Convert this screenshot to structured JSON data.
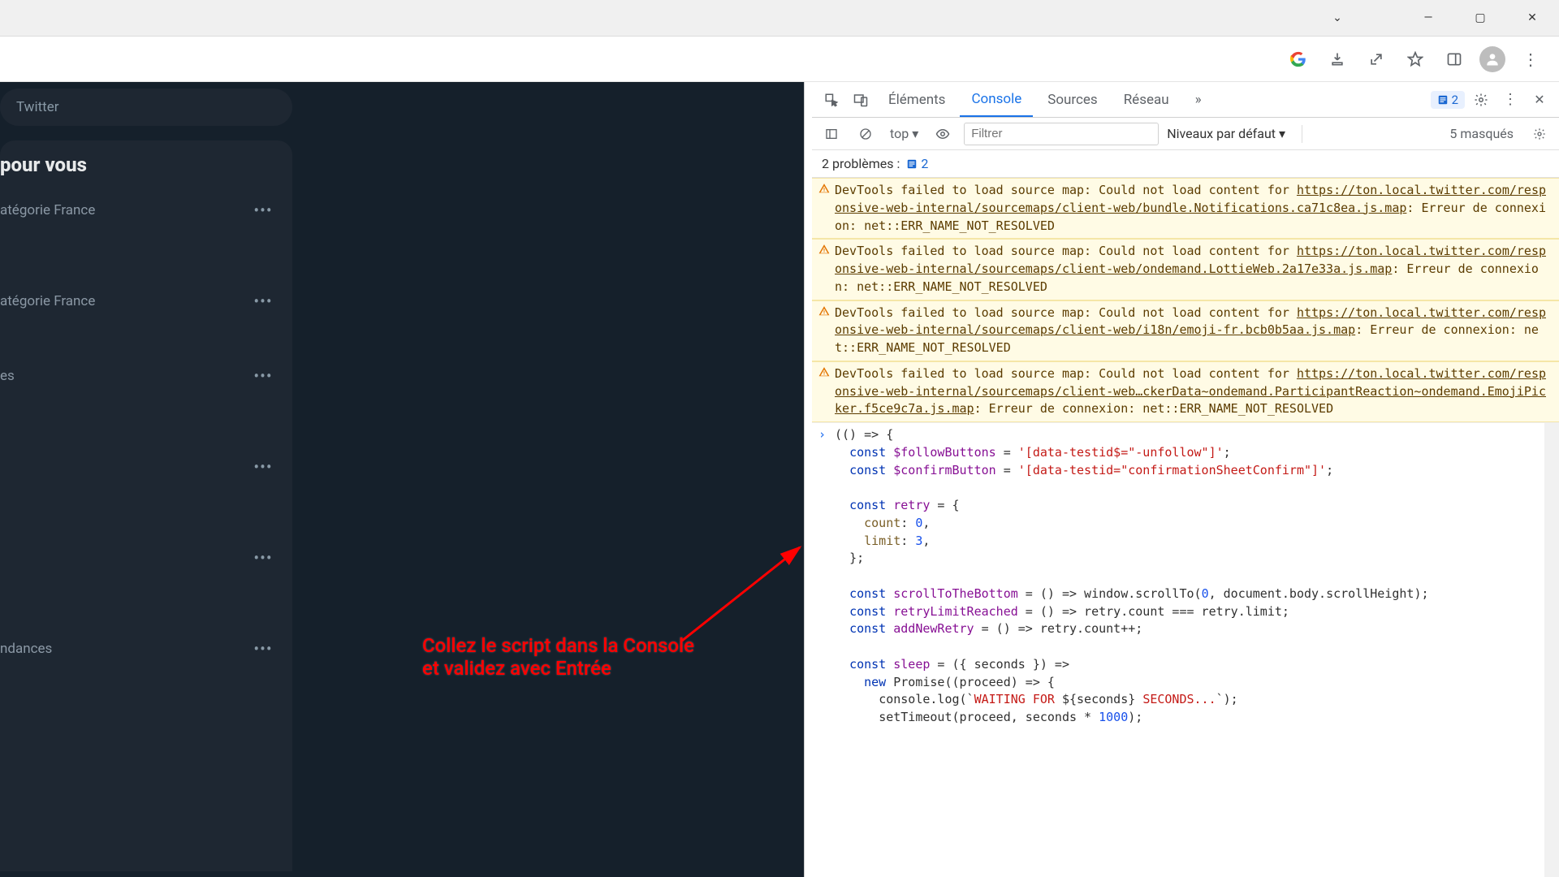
{
  "titlebar": {
    "chevron": "⌄",
    "min": "—",
    "max": "▢",
    "close": "✕"
  },
  "chrome": {
    "google": "G",
    "download": "⭳",
    "share": "↗",
    "star": "☆",
    "sidepanel": "▣",
    "avatar": "👤",
    "menu": "⋮"
  },
  "twitter": {
    "search_placeholder": "Twitter",
    "panel_title": "pour vous",
    "items": [
      {
        "label": "atégorie France"
      },
      {
        "label": "atégorie France"
      },
      {
        "label": "es"
      },
      {
        "label": ""
      },
      {
        "label": ""
      },
      {
        "label": "ndances"
      }
    ],
    "more": "•••"
  },
  "annotation": {
    "line1": "Collez le script dans la Console",
    "line2": "et validez avec Entrée"
  },
  "devtools": {
    "tabs": {
      "elements": "Éléments",
      "console": "Console",
      "sources": "Sources",
      "network": "Réseau",
      "more": "»"
    },
    "issues_count": "2",
    "subbar": {
      "context": "top",
      "filter_placeholder": "Filtrer",
      "levels": "Niveaux par défaut",
      "hidden": "5 masqués"
    },
    "problems": {
      "label": "2 problèmes :",
      "count": "2"
    },
    "warnings": [
      {
        "prefix": "DevTools failed to load source map: Could not load content for ",
        "url": "https://ton.local.twitter.com/responsive-web-internal/sourcemaps/client-web/bundle.Notifications.ca71c8ea.js.map",
        "suffix": ": Erreur de connexion: net::ERR_NAME_NOT_RESOLVED"
      },
      {
        "prefix": "DevTools failed to load source map: Could not load content for ",
        "url": "https://ton.local.twitter.com/responsive-web-internal/sourcemaps/client-web/ondemand.LottieWeb.2a17e33a.js.map",
        "suffix": ": Erreur de connexion: net::ERR_NAME_NOT_RESOLVED"
      },
      {
        "prefix": "DevTools failed to load source map: Could not load content for ",
        "url": "https://ton.local.twitter.com/responsive-web-internal/sourcemaps/client-web/i18n/emoji-fr.bcb0b5aa.js.map",
        "suffix": ": Erreur de connexion: net::ERR_NAME_NOT_RESOLVED"
      },
      {
        "prefix": "DevTools failed to load source map: Could not load content for ",
        "url": "https://ton.local.twitter.com/responsive-web-internal/sourcemaps/client-web…ckerData~ondemand.ParticipantReaction~ondemand.EmojiPicker.f5ce9c7a.js.map",
        "suffix": ": Erreur de connexion: net::ERR_NAME_NOT_RESOLVED"
      }
    ],
    "code": {
      "l0_a": "(() => {",
      "l1_kw": "const",
      "l1_var": "$followButtons",
      "l1_eq": " = ",
      "l1_str": "'[data-testid$=\"-unfollow\"]'",
      "l1_end": ";",
      "l2_kw": "const",
      "l2_var": "$confirmButton",
      "l2_eq": " = ",
      "l2_str": "'[data-testid=\"confirmationSheetConfirm\"]'",
      "l2_end": ";",
      "l4_kw": "const",
      "l4_var": "retry",
      "l4_rest": " = {",
      "l5_prop": "count",
      "l5_rest": ": ",
      "l5_num": "0",
      "l5_end": ",",
      "l6_prop": "limit",
      "l6_rest": ": ",
      "l6_num": "3",
      "l6_end": ",",
      "l7": "};",
      "l9_kw": "const",
      "l9_var": "scrollToTheBottom",
      "l9_rest": " = () => window.scrollTo(",
      "l9_num": "0",
      "l9_mid": ", document.body.scrollHeight);",
      "l10_kw": "const",
      "l10_var": "retryLimitReached",
      "l10_rest": " = () => retry.count === retry.limit;",
      "l11_kw": "const",
      "l11_var": "addNewRetry",
      "l11_rest": " = () => retry.count++;",
      "l13_kw": "const",
      "l13_var": "sleep",
      "l13_rest": " = ({ seconds }) =>",
      "l14_kw": "new",
      "l14_rest": " Promise((proceed) => {",
      "l15_a": "console.log(`",
      "l15_str1": "WAITING FOR ",
      "l15_mid": "${seconds} ",
      "l15_str2": "SECONDS...",
      "l15_b": "`);",
      "l16_a": "setTimeout(proceed, seconds * ",
      "l16_num": "1000",
      "l16_b": ");"
    }
  }
}
